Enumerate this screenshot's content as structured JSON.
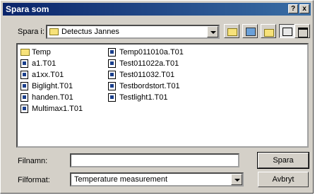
{
  "window": {
    "title": "Spara som",
    "help_label": "?",
    "close_label": "x"
  },
  "save_in": {
    "label_prefix": "Spara i",
    "value": "Detectus Jannes"
  },
  "files": [
    "Temp",
    "a1.T01",
    "a1xx.T01",
    "Biglight.T01",
    "handen.T01",
    "Multimax1.T01",
    "Temp011010a.T01",
    "Test011022a.T01",
    "Test011032.T01",
    "Testbordstort.T01",
    "Testlight1.T01"
  ],
  "filename": {
    "label": "Filnamn:",
    "value": ""
  },
  "format": {
    "label": "Filformat:",
    "value": "Temperature measurement"
  },
  "buttons": {
    "save": "Spara",
    "cancel": "Avbryt"
  },
  "toolbar_icons": [
    "up-folder-icon",
    "desktop-icon",
    "new-folder-icon",
    "list-view-icon",
    "details-view-icon"
  ]
}
